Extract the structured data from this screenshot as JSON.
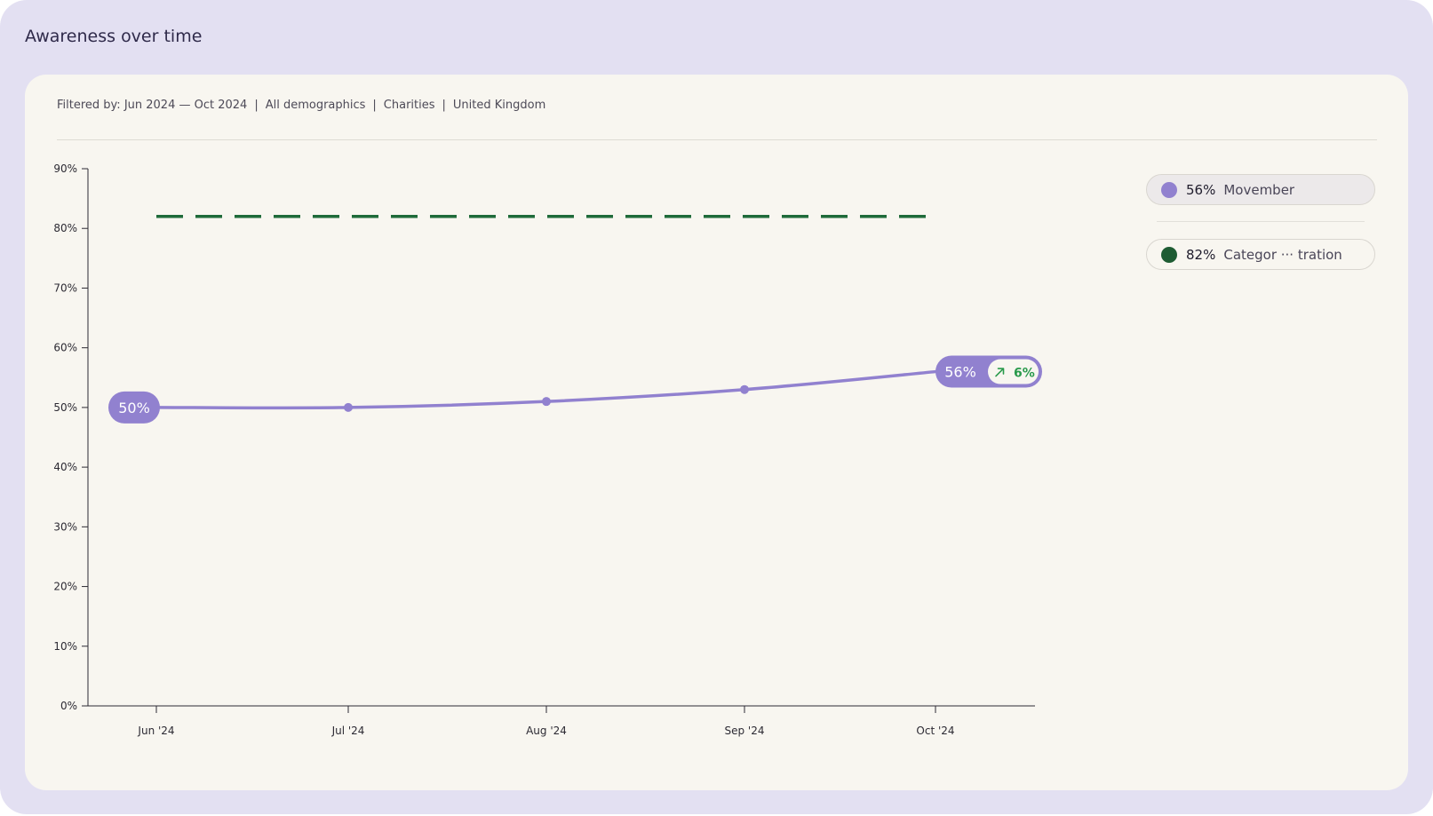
{
  "title": "Awareness over time",
  "filter": {
    "prefix": "Filtered by:",
    "items": [
      "Jun 2024 — Oct 2024",
      "All demographics",
      "Charities",
      "United Kingdom"
    ]
  },
  "legend": [
    {
      "value": "56%",
      "label": "Movember",
      "color": "#9181cf"
    },
    {
      "value": "82%",
      "label": "Categor ··· tration",
      "color": "#1e5c33"
    }
  ],
  "callouts": {
    "start": "50%",
    "end": "56%",
    "change": "6%",
    "change_icon": "arrow-up-right-icon"
  },
  "chart_data": {
    "type": "line",
    "title": "Awareness over time",
    "categories": [
      "Jun '24",
      "Jul '24",
      "Aug '24",
      "Sep '24",
      "Oct '24"
    ],
    "series": [
      {
        "name": "Movember",
        "values": [
          50,
          50,
          51,
          53,
          56
        ],
        "color": "#9181cf",
        "style": "solid"
      },
      {
        "name": "Categor ··· tration",
        "values": [
          82,
          82,
          82,
          82,
          82
        ],
        "color": "#1f6b3a",
        "style": "dashed"
      }
    ],
    "yticks": [
      "0%",
      "10%",
      "20%",
      "30%",
      "40%",
      "50%",
      "60%",
      "70%",
      "80%",
      "90%"
    ],
    "ylim": [
      0,
      90
    ],
    "grid": false,
    "legend_position": "right"
  }
}
